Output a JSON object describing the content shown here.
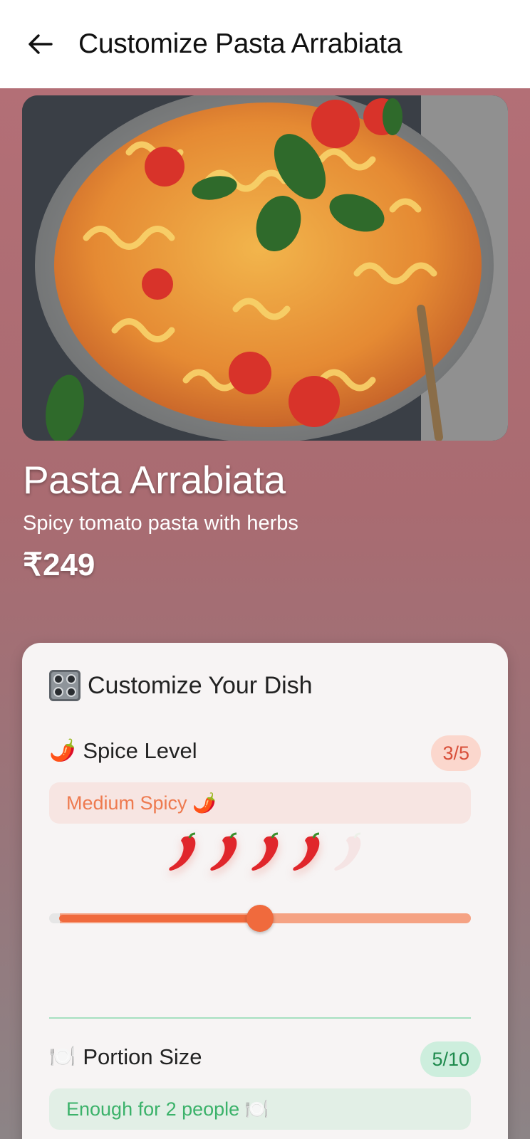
{
  "header": {
    "back_icon": "arrow-left-icon",
    "title": "Customize Pasta Arrabiata"
  },
  "dish": {
    "image": "pasta-arrabiata-photo",
    "name": "Pasta Arrabiata",
    "description": "Spicy tomato pasta with herbs",
    "price": "₹249"
  },
  "customize": {
    "title": "Customize Your Dish",
    "title_icon": "control-knobs-icon",
    "spice": {
      "icon": "🌶️",
      "label": "Spice Level",
      "badge": "3/5",
      "level_text": "Medium Spicy 🌶️",
      "value": 3,
      "max": 5,
      "chili_count_shown": 5,
      "chili_active_count": 4,
      "slider_fraction": 0.5
    },
    "portion": {
      "icon": "🍽️",
      "label": "Portion Size",
      "badge": "5/10",
      "level_text": "Enough for 2 people 🍽️",
      "value": 5,
      "max": 10
    }
  },
  "colors": {
    "accent": "#f06a3d",
    "spice_badge_bg": "#fbd7cd",
    "portion_badge_bg": "#cdeedd",
    "divider": "#a6dfc0"
  }
}
